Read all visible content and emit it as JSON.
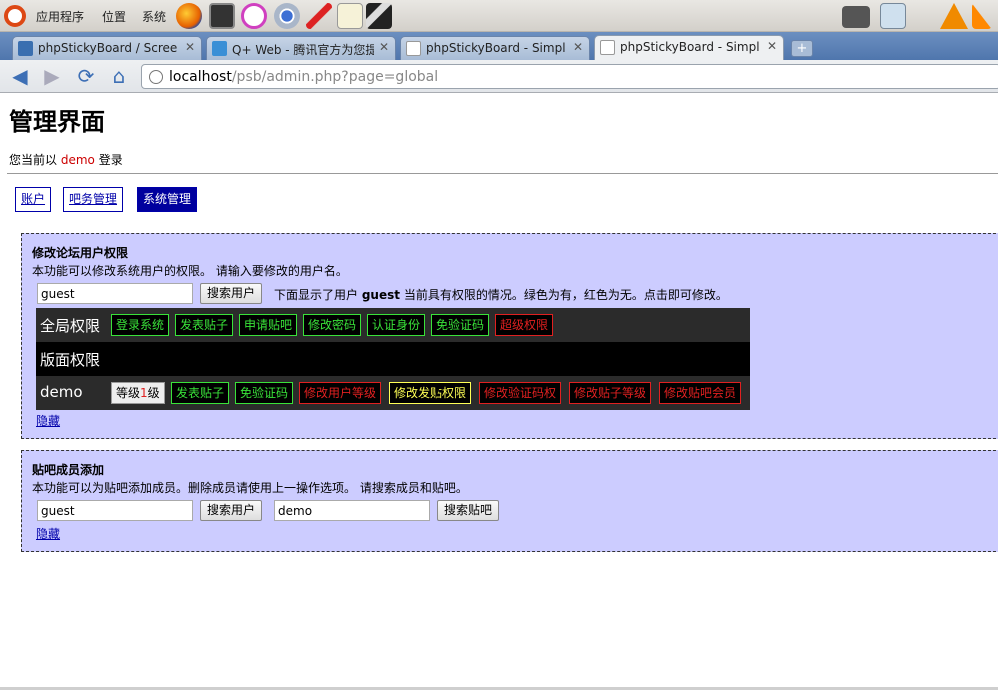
{
  "panel": {
    "menus": [
      "应用程序",
      "位置",
      "系统"
    ]
  },
  "tabs": [
    {
      "title": "phpStickyBoard / Scree",
      "icon": "sourceforge-icon"
    },
    {
      "title": "Q+ Web - 腾讯官方为您提",
      "icon": "qq-icon"
    },
    {
      "title": "phpStickyBoard - Simpl",
      "icon": "page-icon"
    },
    {
      "title": "phpStickyBoard - Simpl",
      "icon": "page-icon"
    }
  ],
  "toolbar": {
    "url_host": "localhost",
    "url_rest": "/psb/admin.php?page=global"
  },
  "page": {
    "title": "管理界面",
    "welcome_prefix": "您当前以",
    "welcome_user": "demo",
    "welcome_suffix": "登录",
    "nav": [
      "账户",
      "吧务管理",
      "系统管理"
    ]
  },
  "perm_panel": {
    "title": "修改论坛用户权限",
    "desc": "本功能可以修改系统用户的权限。 请输入要修改的用户名。",
    "input_value": "guest",
    "search_button": "搜索用户",
    "hint_pre": "下面显示了用户",
    "hint_user": "guest",
    "hint_post": "当前具有权限的情况。绿色为有，红色为无。点击即可修改。",
    "global_label": "全局权限",
    "global_perms": [
      {
        "label": "登录系统",
        "state": "g"
      },
      {
        "label": "发表贴子",
        "state": "g"
      },
      {
        "label": "申请贴吧",
        "state": "g"
      },
      {
        "label": "修改密码",
        "state": "g"
      },
      {
        "label": "认证身份",
        "state": "g"
      },
      {
        "label": "免验证码",
        "state": "g"
      },
      {
        "label": "超级权限",
        "state": "r"
      }
    ],
    "board_label": "版面权限",
    "board_name": "demo",
    "level_prefix": "等级",
    "level_num": "1",
    "level_suffix": "级",
    "board_perms": [
      {
        "label": "发表贴子",
        "state": "g"
      },
      {
        "label": "免验证码",
        "state": "g"
      },
      {
        "label": "修改用户等级",
        "state": "r"
      },
      {
        "label": "修改发贴权限",
        "state": "y"
      },
      {
        "label": "修改验证码权",
        "state": "r"
      },
      {
        "label": "修改贴子等级",
        "state": "r"
      },
      {
        "label": "修改贴吧会员",
        "state": "r"
      }
    ],
    "hide_link": "隐藏"
  },
  "member_panel": {
    "title": "贴吧成员添加",
    "desc": "本功能可以为贴吧添加成员。删除成员请使用上一操作选项。 请搜索成员和贴吧。",
    "user_value": "guest",
    "user_button": "搜索用户",
    "board_value": "demo",
    "board_button": "搜索贴吧",
    "hide_link": "隐藏"
  },
  "colors": {
    "panel_bg": "#ccccff",
    "active_nav": "#00009e",
    "perm_on": "#39e239",
    "perm_off": "#e02020",
    "perm_hover": "#ffff55"
  }
}
